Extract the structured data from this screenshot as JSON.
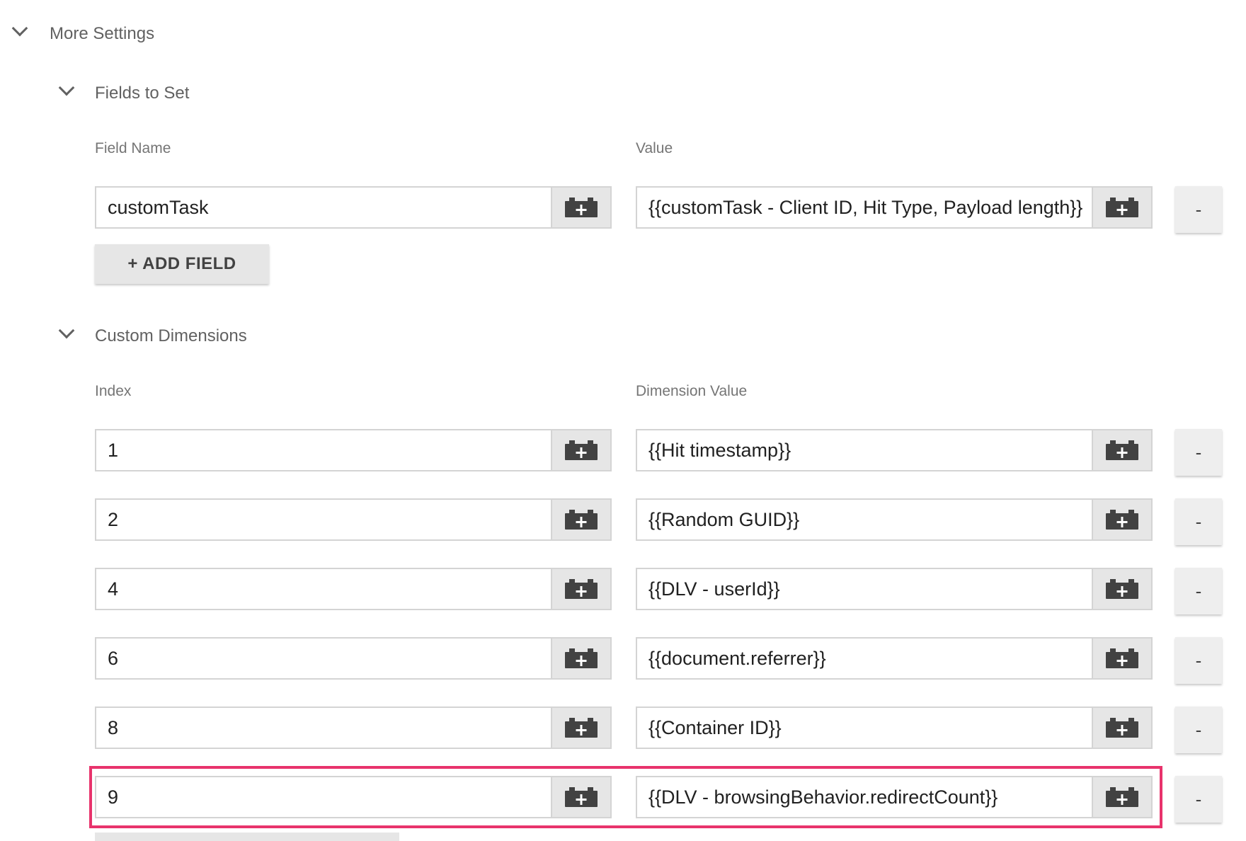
{
  "more_settings": {
    "title": "More Settings"
  },
  "fields_to_set": {
    "title": "Fields to Set",
    "col_name": "Field Name",
    "col_value": "Value",
    "rows": [
      {
        "name": "customTask",
        "value": "{{customTask - Client ID, Hit Type, Payload length}}"
      }
    ],
    "add_label": "+ ADD FIELD"
  },
  "custom_dimensions": {
    "title": "Custom Dimensions",
    "col_index": "Index",
    "col_value": "Dimension Value",
    "rows": [
      {
        "index": "1",
        "value": "{{Hit timestamp}}"
      },
      {
        "index": "2",
        "value": "{{Random GUID}}"
      },
      {
        "index": "4",
        "value": "{{DLV - userId}}"
      },
      {
        "index": "6",
        "value": "{{document.referrer}}"
      },
      {
        "index": "8",
        "value": "{{Container ID}}"
      },
      {
        "index": "9",
        "value": "{{DLV - browsingBehavior.redirectCount}}",
        "highlighted": true
      }
    ]
  },
  "remove_label": "-",
  "colors": {
    "highlight": "#e8336c",
    "button_bg": "#e6e6e6",
    "icon": "#424242"
  },
  "icons": {
    "collapse": "chevron-down-icon",
    "variable": "variable-brick-add-icon"
  }
}
